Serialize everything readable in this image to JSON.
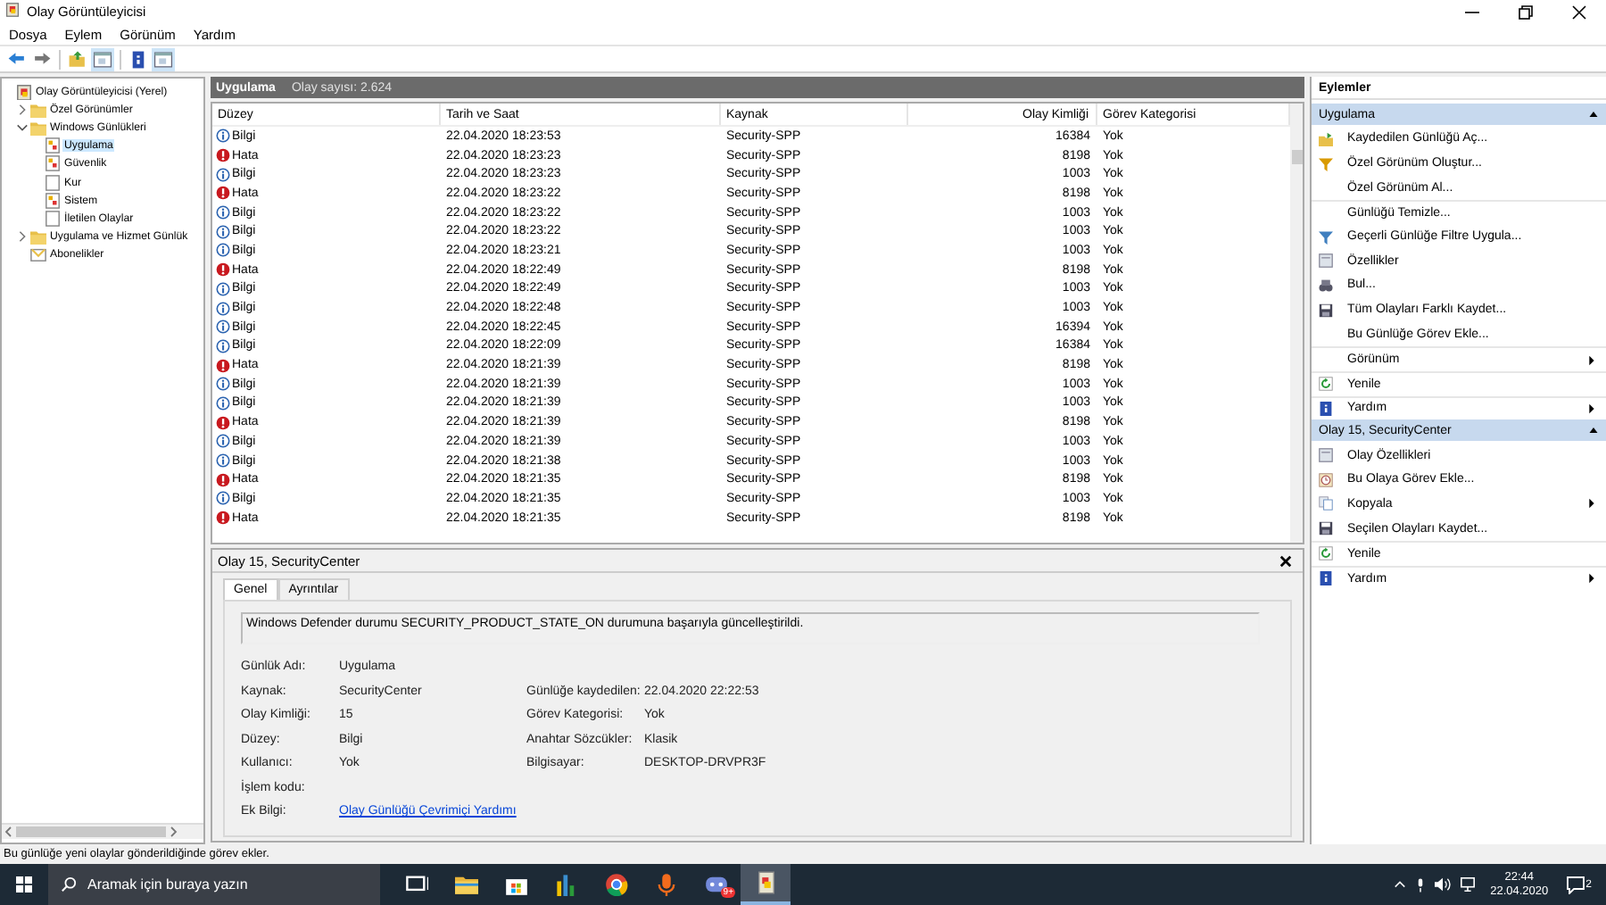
{
  "window": {
    "title": "Olay Görüntüleyicisi"
  },
  "menu": [
    "Dosya",
    "Eylem",
    "Görünüm",
    "Yardım"
  ],
  "toolbar": [
    {
      "kind": "back"
    },
    {
      "kind": "forward"
    },
    {
      "kind": "sep"
    },
    {
      "kind": "folder-up"
    },
    {
      "kind": "panel"
    },
    {
      "kind": "sep"
    },
    {
      "kind": "help"
    },
    {
      "kind": "panel"
    }
  ],
  "tree": [
    {
      "label": "Olay Görüntüleyicisi (Yerel)",
      "kind": "root",
      "selected": false,
      "children": [
        {
          "label": "Özel Görünümler",
          "kind": "folder",
          "selected": false,
          "expanded": false
        },
        {
          "label": "Windows Günlükleri",
          "kind": "folder",
          "selected": false,
          "expanded": true,
          "children": [
            {
              "label": "Uygulama",
              "kind": "log",
              "selected": true
            },
            {
              "label": "Güvenlik",
              "kind": "log",
              "selected": false
            },
            {
              "label": "Kur",
              "kind": "blank",
              "selected": false
            },
            {
              "label": "Sistem",
              "kind": "log",
              "selected": false
            },
            {
              "label": "İletilen Olaylar",
              "kind": "blank",
              "selected": false
            }
          ]
        },
        {
          "label": "Uygulama ve Hizmet Günlük",
          "kind": "folder",
          "selected": false,
          "expanded": false
        },
        {
          "label": "Abonelikler",
          "kind": "sub",
          "selected": false
        }
      ]
    }
  ],
  "log_header": {
    "title": "Uygulama",
    "count": "Olay sayısı: 2.624"
  },
  "table": {
    "columns": [
      "Düzey",
      "Tarih ve Saat",
      "Kaynak",
      "Olay Kimliği",
      "Görev Kategorisi"
    ],
    "rows": [
      {
        "kind": "info",
        "level": "Bilgi",
        "date": "22.04.2020 18:23:53",
        "source": "Security-SPP",
        "id": "16384",
        "category": "Yok"
      },
      {
        "kind": "error",
        "level": "Hata",
        "date": "22.04.2020 18:23:23",
        "source": "Security-SPP",
        "id": "8198",
        "category": "Yok"
      },
      {
        "kind": "info",
        "level": "Bilgi",
        "date": "22.04.2020 18:23:23",
        "source": "Security-SPP",
        "id": "1003",
        "category": "Yok"
      },
      {
        "kind": "error",
        "level": "Hata",
        "date": "22.04.2020 18:23:22",
        "source": "Security-SPP",
        "id": "8198",
        "category": "Yok"
      },
      {
        "kind": "info",
        "level": "Bilgi",
        "date": "22.04.2020 18:23:22",
        "source": "Security-SPP",
        "id": "1003",
        "category": "Yok"
      },
      {
        "kind": "info",
        "level": "Bilgi",
        "date": "22.04.2020 18:23:22",
        "source": "Security-SPP",
        "id": "1003",
        "category": "Yok"
      },
      {
        "kind": "info",
        "level": "Bilgi",
        "date": "22.04.2020 18:23:21",
        "source": "Security-SPP",
        "id": "1003",
        "category": "Yok"
      },
      {
        "kind": "error",
        "level": "Hata",
        "date": "22.04.2020 18:22:49",
        "source": "Security-SPP",
        "id": "8198",
        "category": "Yok"
      },
      {
        "kind": "info",
        "level": "Bilgi",
        "date": "22.04.2020 18:22:49",
        "source": "Security-SPP",
        "id": "1003",
        "category": "Yok"
      },
      {
        "kind": "info",
        "level": "Bilgi",
        "date": "22.04.2020 18:22:48",
        "source": "Security-SPP",
        "id": "1003",
        "category": "Yok"
      },
      {
        "kind": "info",
        "level": "Bilgi",
        "date": "22.04.2020 18:22:45",
        "source": "Security-SPP",
        "id": "16394",
        "category": "Yok"
      },
      {
        "kind": "info",
        "level": "Bilgi",
        "date": "22.04.2020 18:22:09",
        "source": "Security-SPP",
        "id": "16384",
        "category": "Yok"
      },
      {
        "kind": "error",
        "level": "Hata",
        "date": "22.04.2020 18:21:39",
        "source": "Security-SPP",
        "id": "8198",
        "category": "Yok"
      },
      {
        "kind": "info",
        "level": "Bilgi",
        "date": "22.04.2020 18:21:39",
        "source": "Security-SPP",
        "id": "1003",
        "category": "Yok"
      },
      {
        "kind": "info",
        "level": "Bilgi",
        "date": "22.04.2020 18:21:39",
        "source": "Security-SPP",
        "id": "1003",
        "category": "Yok"
      },
      {
        "kind": "error",
        "level": "Hata",
        "date": "22.04.2020 18:21:39",
        "source": "Security-SPP",
        "id": "8198",
        "category": "Yok"
      },
      {
        "kind": "info",
        "level": "Bilgi",
        "date": "22.04.2020 18:21:39",
        "source": "Security-SPP",
        "id": "1003",
        "category": "Yok"
      },
      {
        "kind": "info",
        "level": "Bilgi",
        "date": "22.04.2020 18:21:38",
        "source": "Security-SPP",
        "id": "1003",
        "category": "Yok"
      },
      {
        "kind": "error",
        "level": "Hata",
        "date": "22.04.2020 18:21:35",
        "source": "Security-SPP",
        "id": "8198",
        "category": "Yok"
      },
      {
        "kind": "info",
        "level": "Bilgi",
        "date": "22.04.2020 18:21:35",
        "source": "Security-SPP",
        "id": "1003",
        "category": "Yok"
      },
      {
        "kind": "error",
        "level": "Hata",
        "date": "22.04.2020 18:21:35",
        "source": "Security-SPP",
        "id": "8198",
        "category": "Yok"
      }
    ]
  },
  "detail": {
    "title": "Olay 15, SecurityCenter",
    "tabs": [
      {
        "label": "Genel",
        "selected": true
      },
      {
        "label": "Ayrıntılar",
        "selected": false
      }
    ],
    "message": "Windows Defender durumu SECURITY_PRODUCT_STATE_ON durumuna başarıyla güncelleştirildi.",
    "rows": [
      {
        "left": {
          "label": "Günlük Adı:",
          "value": "Uygulama"
        }
      },
      {
        "left": {
          "label": "Kaynak:",
          "value": "SecurityCenter"
        },
        "right": {
          "label": "Günlüğe kaydedilen:",
          "value": "22.04.2020 22:22:53"
        }
      },
      {
        "left": {
          "label": "Olay Kimliği:",
          "value": "15"
        },
        "right": {
          "label": "Görev Kategorisi:",
          "value": "Yok"
        }
      },
      {
        "left": {
          "label": "Düzey:",
          "value": "Bilgi"
        },
        "right": {
          "label": "Anahtar Sözcükler:",
          "value": "Klasik"
        }
      },
      {
        "left": {
          "label": "Kullanıcı:",
          "value": "Yok"
        },
        "right": {
          "label": "Bilgisayar:",
          "value": "DESKTOP-DRVPR3F"
        }
      },
      {
        "left": {
          "label": "İşlem kodu:"
        }
      },
      {
        "left": {
          "label": "Ek Bilgi:",
          "link": "Olay Günlüğü Çevrimiçi Yardımı"
        }
      }
    ]
  },
  "actions": {
    "title": "Eylemler",
    "sections": [
      {
        "title": "Uygulama",
        "items": [
          {
            "label": "Kaydedilen Günlüğü Aç...",
            "kind": "folder"
          },
          {
            "label": "Özel Görünüm Oluştur...",
            "kind": "filter"
          },
          {
            "label": "Özel Görünüm Al..."
          },
          {
            "label": "Günlüğü Temizle...",
            "divider": true
          },
          {
            "label": "Geçerli Günlüğe Filtre Uygula...",
            "kind": "filter2"
          },
          {
            "label": "Özellikler",
            "kind": "props"
          },
          {
            "label": "Bul...",
            "kind": "find"
          },
          {
            "label": "Tüm Olayları Farklı Kaydet...",
            "kind": "save"
          },
          {
            "label": "Bu Günlüğe Görev Ekle..."
          },
          {
            "label": "Görünüm",
            "submenu": true,
            "divider": true
          },
          {
            "label": "Yenile",
            "kind": "refresh",
            "divider": true
          },
          {
            "label": "Yardım",
            "kind": "help",
            "submenu": true,
            "divider": true
          }
        ]
      },
      {
        "title": "Olay 15, SecurityCenter",
        "items": [
          {
            "label": "Olay Özellikleri",
            "kind": "props"
          },
          {
            "label": "Bu Olaya Görev Ekle...",
            "kind": "task"
          },
          {
            "label": "Kopyala",
            "kind": "copy",
            "submenu": true
          },
          {
            "label": "Seçilen Olayları Kaydet...",
            "kind": "save"
          },
          {
            "label": "Yenile",
            "kind": "refresh",
            "divider": true
          },
          {
            "label": "Yardım",
            "kind": "help",
            "submenu": true,
            "divider": true
          }
        ]
      }
    ]
  },
  "status_bar": "Bu günlüğe yeni olaylar gönderildiğinde görev ekler.",
  "taskbar": {
    "search": {
      "placeholder": "Aramak için buraya yazın"
    },
    "apps": [
      {
        "kind": "taskview",
        "active": false
      },
      {
        "kind": "explorer",
        "active": false
      },
      {
        "kind": "store",
        "active": false
      },
      {
        "kind": "chart",
        "active": false
      },
      {
        "kind": "browser",
        "active": false
      },
      {
        "kind": "mic",
        "active": false
      },
      {
        "kind": "chat",
        "active": false,
        "badge": "9+"
      },
      {
        "kind": "eventviewer",
        "active": true
      }
    ],
    "time": "22:44",
    "date": "22.04.2020",
    "notifications": "2"
  }
}
